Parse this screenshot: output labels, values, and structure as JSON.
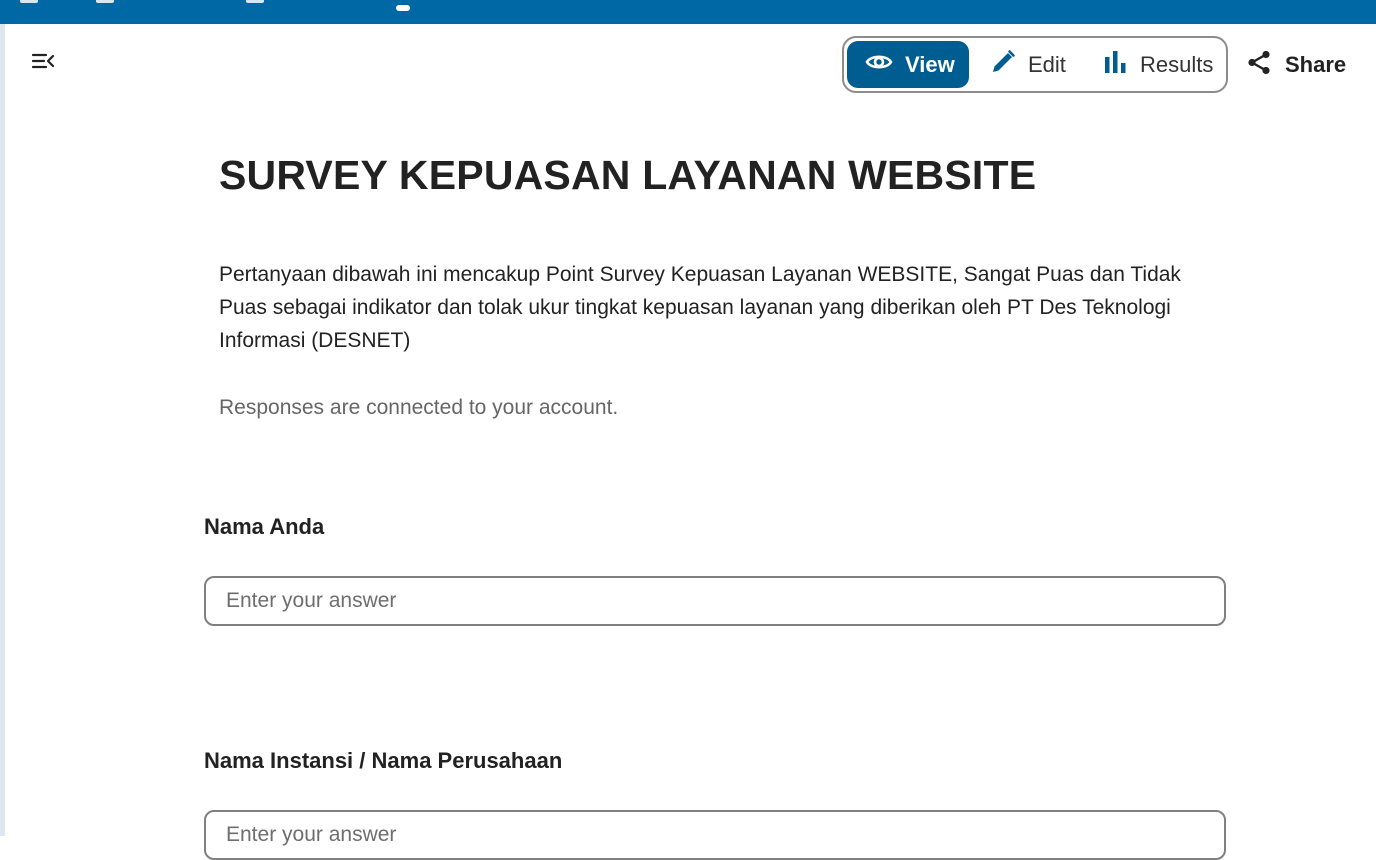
{
  "header": {
    "modes": {
      "view_label": "View",
      "edit_label": "Edit",
      "results_label": "Results"
    },
    "share_label": "Share",
    "icons": [
      "menu-collapse-icon",
      "eye-icon",
      "pencil-icon",
      "bar-chart-icon",
      "share-icon"
    ],
    "accent_color": "#005d91"
  },
  "form": {
    "title": "SURVEY KEPUASAN LAYANAN WEBSITE",
    "description": "Pertanyaan dibawah ini mencakup Point Survey Kepuasan Layanan WEBSITE, Sangat Puas dan Tidak Puas sebagai indikator dan tolak ukur tingkat kepuasan layanan yang diberikan oleh PT Des Teknologi Informasi (DESNET)",
    "notice": "Responses are connected to your account.",
    "questions": [
      {
        "label": "Nama Anda",
        "placeholder": "Enter your answer",
        "value": ""
      },
      {
        "label": "Nama Instansi / Nama Perusahaan",
        "placeholder": "Enter your answer",
        "value": ""
      }
    ]
  }
}
